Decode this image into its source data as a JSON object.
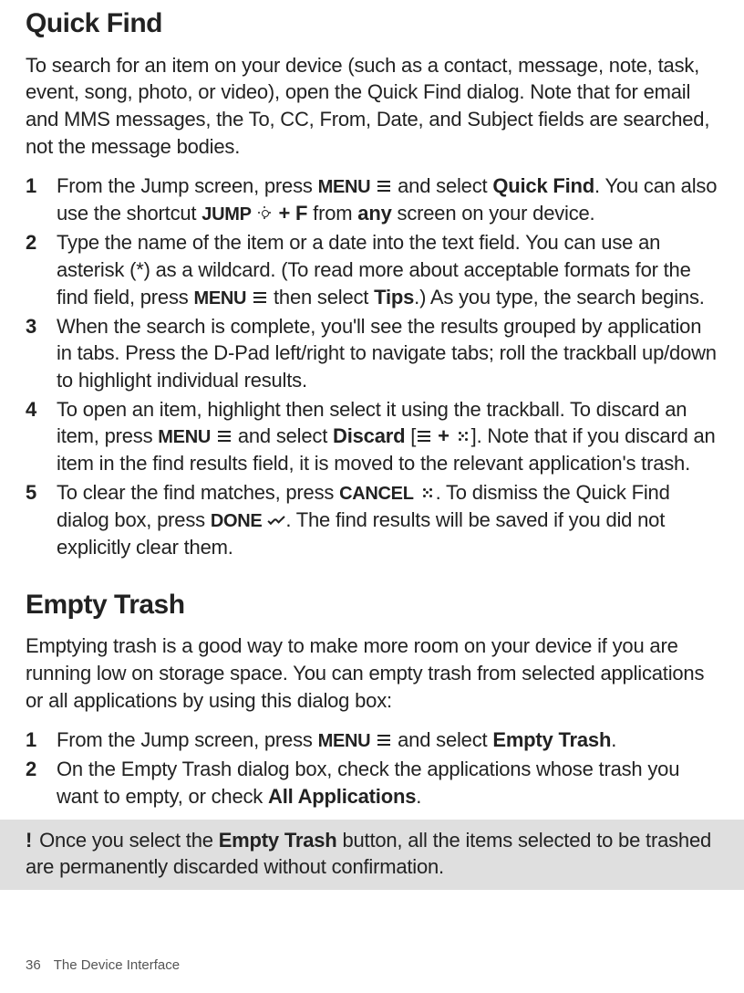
{
  "sections": {
    "quickfind": {
      "title": "Quick Find",
      "intro": "To search for an item on your device (such as a contact, message, note, task, event, song, photo, or video), open the Quick Find dialog. Note that for email and MMS messages, the To, CC, From, Date, and Subject fields are searched, not the message bodies.",
      "steps": {
        "s1": {
          "a": "From the Jump screen, press ",
          "menu": "MENU",
          "b": " and select ",
          "qf": "Quick Find",
          "c": ". You can also use the shortcut ",
          "jump": "JUMP",
          "d": " + F",
          "e": " from ",
          "any": "any",
          "f": " screen on your device."
        },
        "s2": {
          "a": "Type the name of the item or a date into the text field. You can use an asterisk (*) as a wildcard. (To read more about acceptable formats for the find field, press ",
          "menu": "MENU",
          "b": " then select ",
          "tips": "Tips",
          "c": ".) As you type, the search begins."
        },
        "s3": "When the search is complete, you'll see the results grouped by application in tabs. Press the D-Pad left/right to navigate tabs; roll the trackball up/down to highlight individual results.",
        "s4": {
          "a": "To open an item, highlight then select it using the trackball. To discard an item, press ",
          "menu": "MENU",
          "b": " and select ",
          "discard": "Discard",
          "c": " [",
          "plus": " + ",
          "d": "]. Note that if you discard an item in the find results field, it is moved to the relevant application's trash."
        },
        "s5": {
          "a": "To clear the find matches, press ",
          "cancel": "CANCEL",
          "b": ". To dismiss the Quick Find dialog box, press ",
          "done": "DONE",
          "c": ". The find results will be saved if you did not explicitly clear them."
        }
      }
    },
    "emptytrash": {
      "title": "Empty Trash",
      "intro": "Emptying trash is a good way to make more room on your device if you are running low on storage space. You can empty trash from selected applications or all applications by using this dialog box:",
      "steps": {
        "s1": {
          "a": "From the Jump screen, press ",
          "menu": "MENU",
          "b": " and select ",
          "et": "Empty Trash",
          "c": "."
        },
        "s2": {
          "a": "On the Empty Trash dialog box, check the applications whose trash you want to empty, or check ",
          "all": "All Applications",
          "b": "."
        }
      },
      "warning": {
        "bang": "!",
        "a": "Once you select the ",
        "et": "Empty Trash",
        "b": " button, all the items selected to be trashed are permanently discarded without confirmation."
      }
    }
  },
  "nums": {
    "n1": "1",
    "n2": "2",
    "n3": "3",
    "n4": "4",
    "n5": "5"
  },
  "footer": {
    "page": "36",
    "title": "The Device Interface"
  }
}
